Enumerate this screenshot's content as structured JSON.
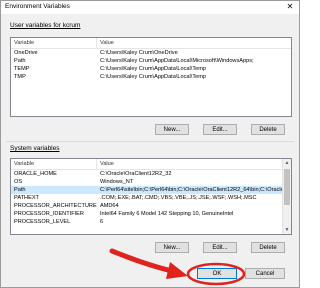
{
  "window": {
    "title": "Environment Variables",
    "close_glyph": "✕"
  },
  "user_section": {
    "label": "User variables for kcrum",
    "columns": [
      "Variable",
      "Value"
    ],
    "rows": [
      {
        "variable": "OneDrive",
        "value": "C:\\Users\\Kaley Crum\\OneDrive"
      },
      {
        "variable": "Path",
        "value": "C:\\Users\\Kaley Crum\\AppData\\Local\\Microsoft\\WindowsApps;"
      },
      {
        "variable": "TEMP",
        "value": "C:\\Users\\Kaley Crum\\AppData\\Local\\Temp"
      },
      {
        "variable": "TMP",
        "value": "C:\\Users\\Kaley Crum\\AppData\\Local\\Temp"
      }
    ],
    "buttons": {
      "new": "New...",
      "edit": "Edit...",
      "delete": "Delete"
    }
  },
  "system_section": {
    "label": "System variables",
    "columns": [
      "Variable",
      "Value"
    ],
    "rows": [
      {
        "variable": "ORACLE_HOME",
        "value": "C:\\Oracle\\OraClient12R2_32"
      },
      {
        "variable": "OS",
        "value": "Windows_NT"
      },
      {
        "variable": "Path",
        "value": "C:\\Perl64\\site\\bin;C:\\Perl64\\bin;C:\\Oracle\\OraClient12R2_64\\bin;C:\\Oracle"
      },
      {
        "variable": "PATHEXT",
        "value": ".COM;.EXE;.BAT;.CMD;.VBS;.VBE;.JS;.JSE;.WSF;.WSH;.MSC"
      },
      {
        "variable": "PROCESSOR_ARCHITECTURE",
        "value": "AMD64"
      },
      {
        "variable": "PROCESSOR_IDENTIFIER",
        "value": "Intel64 Family 6 Model 142 Stepping 10, GenuineIntel"
      },
      {
        "variable": "PROCESSOR_LEVEL",
        "value": "6"
      }
    ],
    "selected_index": 2,
    "buttons": {
      "new": "New...",
      "edit": "Edit...",
      "delete": "Delete"
    }
  },
  "footer": {
    "ok": "OK",
    "cancel": "Cancel"
  },
  "colors": {
    "annotation_red": "#e0231d",
    "selection": "#cce8ff",
    "ok_border": "#0078d7"
  },
  "icons": {
    "scroll_up": "▲",
    "scroll_down": "▼"
  }
}
